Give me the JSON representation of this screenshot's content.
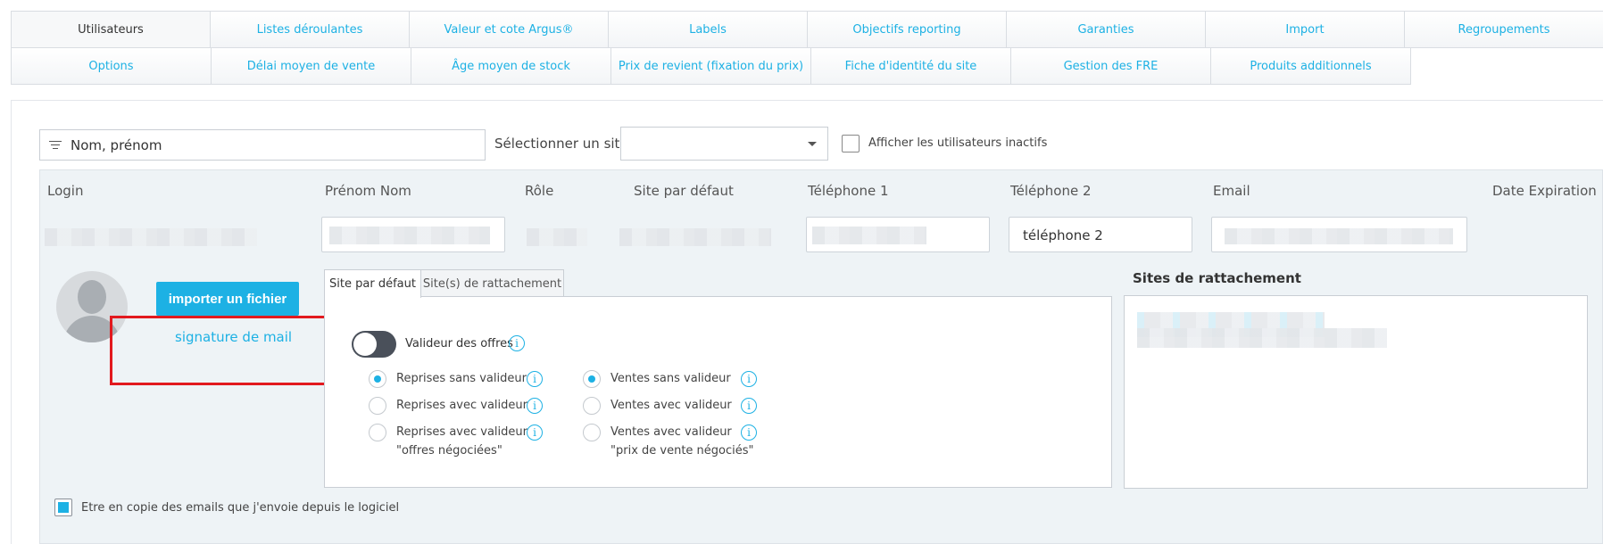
{
  "nav": {
    "row1": [
      "Utilisateurs",
      "Listes déroulantes",
      "Valeur et cote Argus®",
      "Labels",
      "Objectifs reporting",
      "Garanties",
      "Import",
      "Regroupements"
    ],
    "row2": [
      "Options",
      "Délai moyen de vente",
      "Âge moyen de stock",
      "Prix de revient (fixation du prix)",
      "Fiche d'identité du site",
      "Gestion des FRE",
      "Produits additionnels"
    ],
    "active": "Utilisateurs"
  },
  "filters": {
    "name_placeholder": "Nom, prénom",
    "site_label": "Sélectionner un site",
    "site_value": "",
    "inactive_label": "Afficher les utilisateurs inactifs"
  },
  "columns": [
    "Login",
    "Prénom Nom",
    "Rôle",
    "Site par défaut",
    "Téléphone 1",
    "Téléphone 2",
    "Email",
    "Date Expiration"
  ],
  "row": {
    "phone2_placeholder": "téléphone 2"
  },
  "profile": {
    "import_button": "importer un fichier",
    "signature_link": "signature de mail"
  },
  "tabs": [
    "Site par défaut",
    "Site(s) de rattachement"
  ],
  "validation": {
    "toggle_label": "Valideur des offres",
    "reprises": [
      {
        "label": "Reprises sans valideur",
        "checked": true
      },
      {
        "label": "Reprises avec valideur",
        "checked": false
      },
      {
        "label": "Reprises avec valideur",
        "label2": "\"offres négociées\"",
        "checked": false
      }
    ],
    "ventes": [
      {
        "label": "Ventes sans valideur",
        "checked": true
      },
      {
        "label": "Ventes avec valideur",
        "checked": false
      },
      {
        "label": "Ventes avec valideur",
        "label2": "\"prix de vente négociés\"",
        "checked": false
      }
    ],
    "info_glyph": "i"
  },
  "sites": {
    "title": "Sites de rattachement"
  },
  "copy_emails": {
    "label": "Etre en copie des emails que j'envoie depuis le logiciel",
    "checked": true
  },
  "colors": {
    "accent": "#1db1e4",
    "highlight": "#e2191e"
  }
}
